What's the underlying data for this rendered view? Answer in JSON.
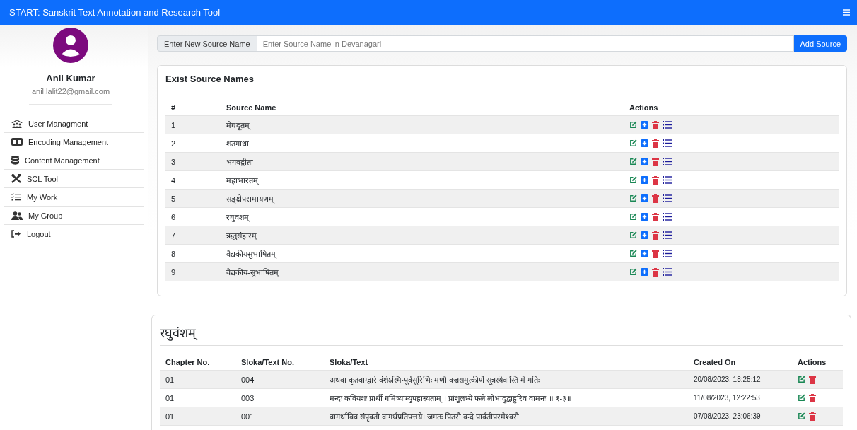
{
  "navbar": {
    "title": "START: Sanskrit Text Annotation and Research Tool"
  },
  "user": {
    "name": "Anil Kumar",
    "email": "anil.lalit22@gmail.com"
  },
  "sidebar": {
    "items": [
      {
        "label": "User Managment",
        "kind": "users"
      },
      {
        "label": "Encoding Management",
        "kind": "card"
      },
      {
        "label": "Content Management",
        "kind": "database"
      },
      {
        "label": "SCL Tool",
        "kind": "tools"
      },
      {
        "label": "My Work",
        "kind": "checklist"
      },
      {
        "label": "My Group",
        "kind": "group"
      },
      {
        "label": "Logout",
        "kind": "logout"
      }
    ]
  },
  "source_form": {
    "label": "Enter New Source Name",
    "placeholder": "Enter Source Name in Devanagari",
    "button": "Add Source"
  },
  "sources": {
    "title": "Exist Source Names",
    "columns": [
      "#",
      "Source Name",
      "Actions"
    ],
    "actions": [
      {
        "kind": "edit"
      },
      {
        "kind": "add"
      },
      {
        "kind": "delete"
      },
      {
        "kind": "list"
      }
    ],
    "rows": [
      {
        "number": "1",
        "name": "मेघदूतम्"
      },
      {
        "number": "2",
        "name": "शतगाथा"
      },
      {
        "number": "3",
        "name": "भगवद्गीता"
      },
      {
        "number": "4",
        "name": "महाभारतम्"
      },
      {
        "number": "5",
        "name": "सङ्क्षेपरामायणम्"
      },
      {
        "number": "6",
        "name": "रघुवंशम्"
      },
      {
        "number": "7",
        "name": "ऋतुसंहारम्"
      },
      {
        "number": "8",
        "name": "वैद्यकीयसुभाषितम्"
      },
      {
        "number": "9",
        "name": "वैद्यकीय-सुभाषितम्"
      }
    ]
  },
  "texts": {
    "title": "रघुवंशम्",
    "columns": [
      "Chapter No.",
      "Sloka/Text No.",
      "Sloka/Text",
      "Created On",
      "Actions"
    ],
    "actions": [
      {
        "kind": "edit"
      },
      {
        "kind": "delete"
      }
    ],
    "rows": [
      {
        "chapter": "01",
        "sloka_no": "004",
        "text": "अथवा कृतवाग्द्वारे वंशेऽस्मिन्पूर्वसूरिभिः मणौ वज्रसमुत्कीर्णे सूत्रस्येवास्ति मे गतिः",
        "created": "20/08/2023, 18:25:12"
      },
      {
        "chapter": "01",
        "sloka_no": "003",
        "text": "मन्दः कवियशः प्रार्थी गमिष्याम्युपहास्यताम् । प्रांशुलभ्ये फले लोभादुद्बाहुरिव वामनः ॥ १-३॥",
        "created": "11/08/2023, 12:22:53"
      },
      {
        "chapter": "01",
        "sloka_no": "001",
        "text": "वागर्थाविव संपृक्तौ वागर्थप्रतिपत्तये। जगतः पितरौ वन्दे पार्वतीपरमेश्वरौ",
        "created": "07/08/2023, 23:06:39"
      }
    ]
  }
}
